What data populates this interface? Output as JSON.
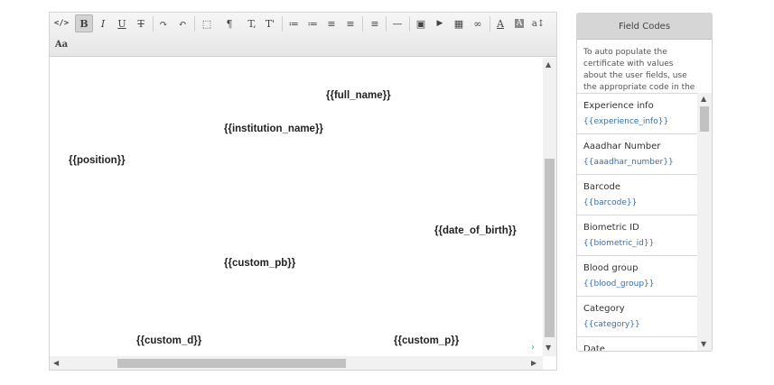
{
  "toolbar": {
    "buttons": [
      {
        "name": "source-code-button",
        "glyph": "</>",
        "active": false
      },
      {
        "name": "bold-button",
        "glyph": "B",
        "active": true
      },
      {
        "name": "italic-button",
        "glyph": "I",
        "active": false
      },
      {
        "name": "underline-button",
        "glyph": "U",
        "active": false
      },
      {
        "name": "strikethrough-button",
        "glyph": "T",
        "active": false
      },
      {
        "name": "redo-button",
        "glyph": "↷",
        "active": false
      },
      {
        "name": "undo-button",
        "glyph": "↶",
        "active": false
      },
      {
        "name": "select-all-button",
        "glyph": "⬚",
        "active": false
      },
      {
        "name": "paragraph-button",
        "glyph": "¶",
        "active": false
      },
      {
        "name": "subscript-button",
        "glyph": "T,",
        "active": false
      },
      {
        "name": "superscript-button",
        "glyph": "T'",
        "active": false
      },
      {
        "name": "bulleted-list-button",
        "glyph": "≔",
        "active": false
      },
      {
        "name": "numbered-list-button",
        "glyph": "≔",
        "active": false
      },
      {
        "name": "outdent-button",
        "glyph": "≡",
        "active": false
      },
      {
        "name": "indent-button",
        "glyph": "≡",
        "active": false
      },
      {
        "name": "align-button",
        "glyph": "≡",
        "active": false
      },
      {
        "name": "horizontal-rule-button",
        "glyph": "—",
        "active": false
      },
      {
        "name": "image-button",
        "glyph": "▣",
        "active": false
      },
      {
        "name": "video-button",
        "glyph": "▶",
        "active": false
      },
      {
        "name": "table-button",
        "glyph": "▦",
        "active": false
      },
      {
        "name": "link-button",
        "glyph": "∞",
        "active": false
      },
      {
        "name": "font-color-button",
        "glyph": "A",
        "active": false
      },
      {
        "name": "background-color-button",
        "glyph": "A",
        "active": false
      },
      {
        "name": "font-size-button",
        "glyph": "a↕",
        "active": false
      }
    ],
    "font_family_glyph": "Aa"
  },
  "canvas": {
    "fields": [
      {
        "text": "{{full_name}}"
      },
      {
        "text": "{{institution_name}}"
      },
      {
        "text": "{{position}}"
      },
      {
        "text": "{{date_of_birth}}"
      },
      {
        "text": "{{custom_pb}}"
      },
      {
        "text": "{{custom_d}}"
      },
      {
        "text": "{{custom_p}}"
      }
    ]
  },
  "panel": {
    "title": "Field Codes",
    "description": "To auto populate the certificate with values about the user fields, use the appropriate code in the form",
    "items": [
      {
        "name": "Experience info",
        "code": "{{experience_info}}"
      },
      {
        "name": "Aaadhar Number",
        "code": "{{aaadhar_number}}"
      },
      {
        "name": "Barcode",
        "code": "{{barcode}}"
      },
      {
        "name": "Biometric ID",
        "code": "{{biometric_id}}"
      },
      {
        "name": "Blood group",
        "code": "{{blood_group}}"
      },
      {
        "name": "Category",
        "code": "{{category}}"
      },
      {
        "name": "Date",
        "code": ""
      }
    ]
  }
}
